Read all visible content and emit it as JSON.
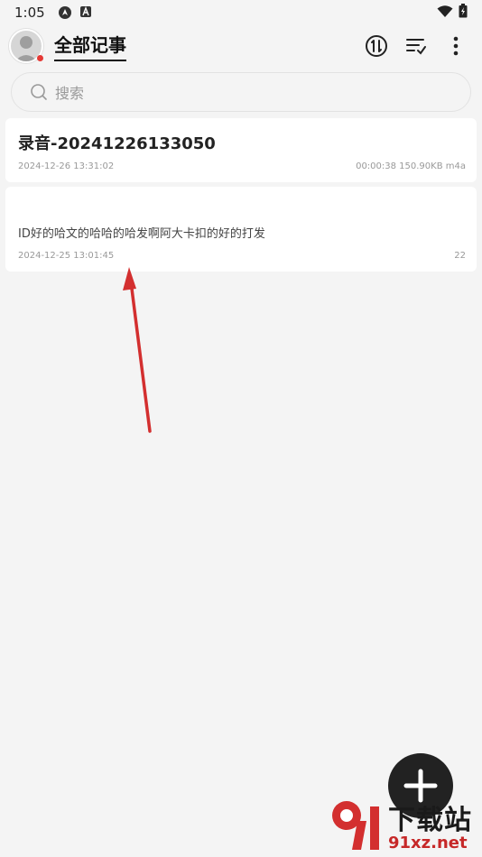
{
  "status_bar": {
    "time": "1:05"
  },
  "header": {
    "title": "全部记事"
  },
  "search": {
    "placeholder": "搜索"
  },
  "notes": [
    {
      "title": "录音-20241226133050",
      "date": "2024-12-26 13:31:02",
      "info": "00:00:38 150.90KB m4a"
    },
    {
      "text": "ID好的哈文的哈哈的哈发啊阿大卡扣的好的打发",
      "date": "2024-12-25 13:01:45",
      "info": "22"
    }
  ],
  "watermark": {
    "brand": "下载站",
    "domain": "91xz.net"
  },
  "colors": {
    "background": "#f4f4f4",
    "card": "#ffffff",
    "accent_red": "#e53935",
    "fab": "#222222"
  },
  "icons": {
    "status": [
      "navigation-icon",
      "app-a-icon",
      "wifi-icon",
      "battery-icon"
    ],
    "header": [
      "sync-icon",
      "sort-icon",
      "more-icon"
    ],
    "search": "search-icon",
    "fab": "plus-icon"
  }
}
